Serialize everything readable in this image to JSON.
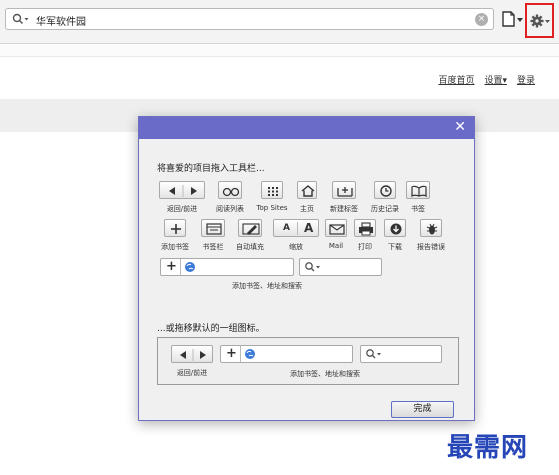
{
  "toolbar": {
    "search_value": "华军软件园",
    "clear_glyph": "×",
    "page_menu_icon": "page-icon",
    "settings_icon": "gear-icon"
  },
  "page_links": {
    "home": "百度首页",
    "settings": "设置▾",
    "login": "登录"
  },
  "dialog": {
    "close_glyph": "✕",
    "hint": "将喜爱的项目拖入工具栏...",
    "items": {
      "back_forward": "返回/前进",
      "reading_list": "阅读列表",
      "top_sites": "Top Sites",
      "home": "主页",
      "new_tab": "新建标签",
      "history": "历史记录",
      "bookmarks": "书签",
      "add_bookmark": "添加书签",
      "bookmarks_bar": "书签栏",
      "autofill": "自动填充",
      "zoom": "缩放",
      "mail": "Mail",
      "print": "打印",
      "download": "下载",
      "report_bug": "报告错误",
      "address_search": "添加书签、地址和搜索"
    },
    "text_zoom_small": "A",
    "text_zoom_large": "A",
    "plus_glyph": "+",
    "default_hint": "...或拖移默认的一组图标。",
    "default_items": {
      "back_forward": "返回/前进",
      "address_search": "添加书签、地址和搜索"
    },
    "done_label": "完成"
  },
  "watermark": "最需网",
  "colors": {
    "dialog_title": "#6a6bc9",
    "highlight_border": "#e02020",
    "watermark": "#2646b8"
  }
}
